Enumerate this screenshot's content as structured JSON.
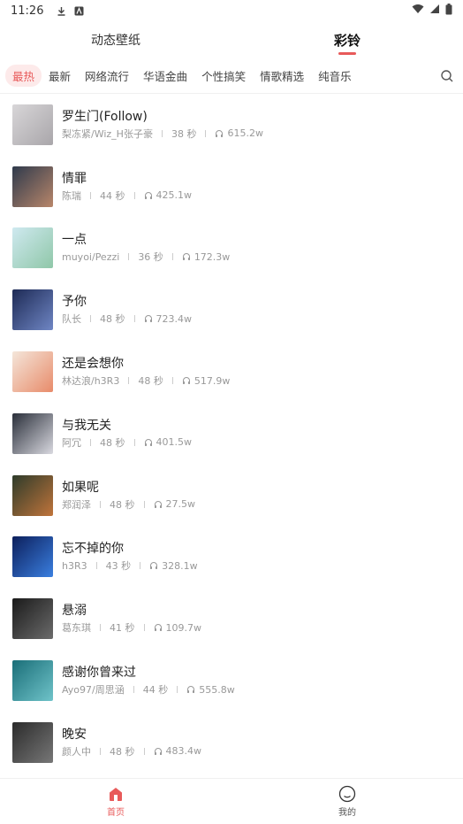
{
  "status_bar": {
    "time": "11:26"
  },
  "top_tabs": [
    {
      "label": "动态壁纸",
      "active": false
    },
    {
      "label": "彩铃",
      "active": true
    }
  ],
  "categories": [
    "最热",
    "最新",
    "网络流行",
    "华语金曲",
    "个性搞笑",
    "情歌精选",
    "纯音乐"
  ],
  "active_category": 0,
  "songs": [
    {
      "title": "罗生门(Follow)",
      "artist": "梨冻紧/Wiz_H张子豪",
      "duration": "38 秒",
      "plays": "615.2w",
      "cover_colors": [
        "#d8d6d8",
        "#a9a6aa"
      ]
    },
    {
      "title": "情罪",
      "artist": "陈瑞",
      "duration": "44 秒",
      "plays": "425.1w",
      "cover_colors": [
        "#2f3a4c",
        "#b8866a"
      ]
    },
    {
      "title": "一点",
      "artist": "muyoi/Pezzi",
      "duration": "36 秒",
      "plays": "172.3w",
      "cover_colors": [
        "#cfe9f0",
        "#8fc7a8"
      ]
    },
    {
      "title": "予你",
      "artist": "队长",
      "duration": "48 秒",
      "plays": "723.4w",
      "cover_colors": [
        "#1d2a55",
        "#6f86c4"
      ]
    },
    {
      "title": "还是会想你",
      "artist": "林达浪/h3R3",
      "duration": "48 秒",
      "plays": "517.9w",
      "cover_colors": [
        "#f4e6da",
        "#e88b6a"
      ]
    },
    {
      "title": "与我无关",
      "artist": "阿冗",
      "duration": "48 秒",
      "plays": "401.5w",
      "cover_colors": [
        "#2a2f3a",
        "#d9d9e0"
      ]
    },
    {
      "title": "如果呢",
      "artist": "郑润泽",
      "duration": "48 秒",
      "plays": "27.5w",
      "cover_colors": [
        "#2e3b2a",
        "#c0743b"
      ]
    },
    {
      "title": "忘不掉的你",
      "artist": "h3R3",
      "duration": "43 秒",
      "plays": "328.1w",
      "cover_colors": [
        "#0c1f5c",
        "#3a7fe0"
      ]
    },
    {
      "title": "悬溺",
      "artist": "葛东琪",
      "duration": "41 秒",
      "plays": "109.7w",
      "cover_colors": [
        "#1a1a1a",
        "#6b6b6b"
      ]
    },
    {
      "title": "感谢你曾来过",
      "artist": "Ayo97/周思涵",
      "duration": "44 秒",
      "plays": "555.8w",
      "cover_colors": [
        "#1a6e78",
        "#6fc3c9"
      ]
    },
    {
      "title": "晚安",
      "artist": "颜人中",
      "duration": "48 秒",
      "plays": "483.4w",
      "cover_colors": [
        "#2b2b2b",
        "#777777"
      ]
    }
  ],
  "bottom_nav": [
    {
      "label": "首页",
      "icon": "home-icon",
      "active": true
    },
    {
      "label": "我的",
      "icon": "profile-icon",
      "active": false
    }
  ],
  "accent_color": "#e85a5a"
}
